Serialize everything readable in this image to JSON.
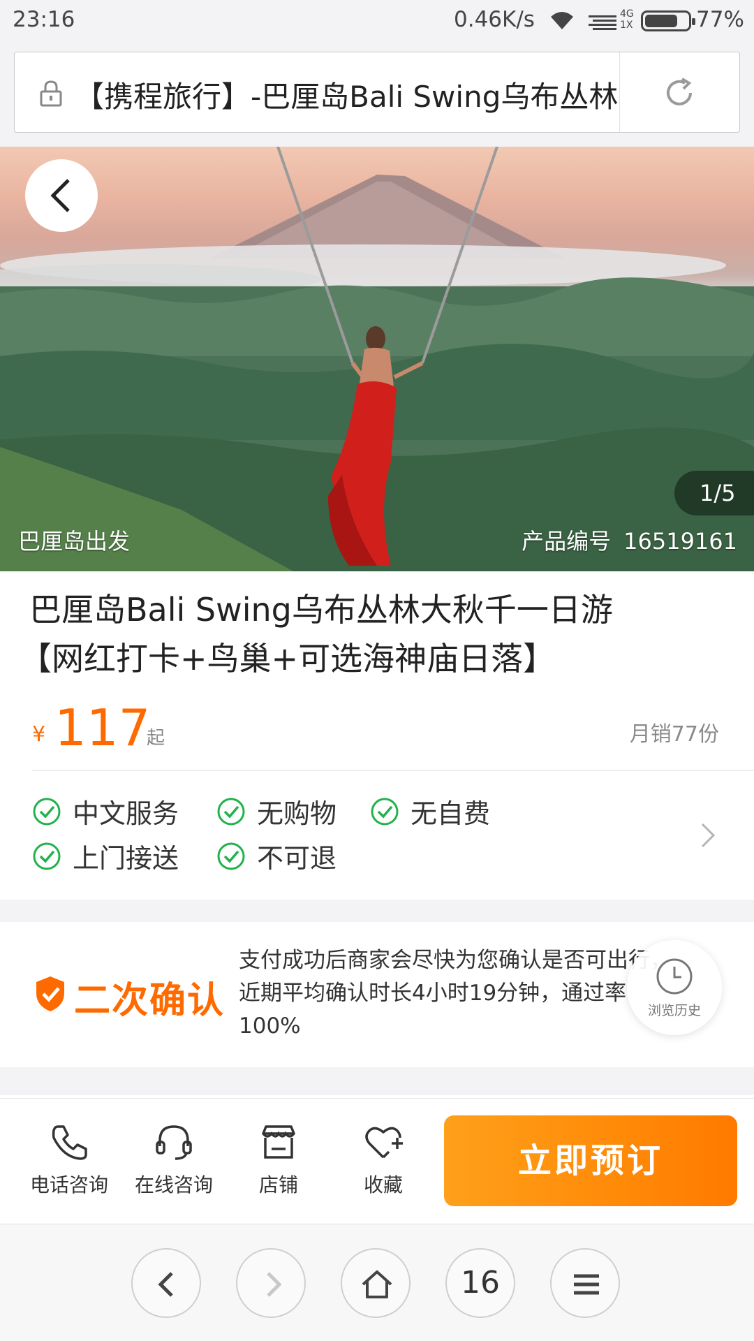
{
  "status_bar": {
    "time": "23:16",
    "net_speed": "0.46K/s",
    "net_type_top": "4G",
    "net_type_bottom": "1X",
    "battery": "77%",
    "battery_level": 0.77
  },
  "address_bar": {
    "url_text": "【携程旅行】-巴厘岛Bali Swing乌布丛林大秋千一日游",
    "lock_icon": "lock-icon",
    "reload_icon": "reload-icon"
  },
  "hero": {
    "counter": "1/5",
    "departure": "巴厘岛出发",
    "product_id_label": "产品编号",
    "product_id": "16519161"
  },
  "product": {
    "title_line1": "巴厘岛Bali Swing乌布丛林大秋千一日游",
    "title_line2": "【网红打卡+鸟巢+可选海神庙日落】",
    "currency": "¥",
    "price": "117",
    "price_suffix": "起",
    "sales": "月销77份"
  },
  "tags": [
    "中文服务",
    "无购物",
    "无自费",
    "上门接送",
    "不可退"
  ],
  "confirm": {
    "title": "二次确认",
    "text": "支付成功后商家会尽快为您确认是否可出行，近期平均确认时长4小时19分钟，通过率100%"
  },
  "floating": {
    "history_label": "浏览历史"
  },
  "action_bar": {
    "items": [
      {
        "label": "电话咨询",
        "icon": "phone-icon"
      },
      {
        "label": "在线咨询",
        "icon": "headset-icon"
      },
      {
        "label": "店铺",
        "icon": "store-icon"
      },
      {
        "label": "收藏",
        "icon": "heart-plus-icon"
      }
    ],
    "book_label": "立即预订"
  },
  "browser_nav": {
    "tab_count": "16"
  },
  "colors": {
    "accent": "#ff6a00",
    "check_green": "#21b24b",
    "book_button": "#ff8a08"
  }
}
